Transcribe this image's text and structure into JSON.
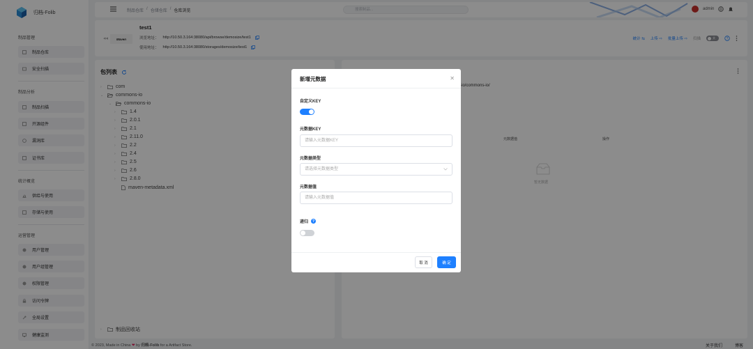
{
  "brand": {
    "name": "归档-Folib"
  },
  "sidebar": {
    "groups": [
      {
        "label": "制品管理",
        "items": [
          "制品仓库",
          "安全扫描"
        ]
      },
      {
        "label": "制品分析",
        "items": [
          "制品扫描",
          "开源组件",
          "漏洞库",
          "证书库"
        ]
      },
      {
        "label": "统计概览",
        "items": [
          "供给与使用",
          "存储与使用"
        ]
      },
      {
        "label": "运营管理",
        "items": [
          "用户管理",
          "用户组管理",
          "权限管理",
          "访问令牌",
          "全局设置",
          "健康监测"
        ]
      }
    ]
  },
  "header": {
    "breadcrumbs": [
      "制品仓库",
      "/",
      "仓储仓库",
      "/",
      "仓库浏览"
    ],
    "search_placeholder": "搜索制品...",
    "user": "admin"
  },
  "repo": {
    "name": "test1",
    "logo_text": "Maven",
    "browse_label": "浏览地址：",
    "browse_url": "http://10.50.3.164:38080/api/browse/demosize/test1",
    "use_label": "使用地址：",
    "use_url": "http://10.50.3.164:38080/storages/demosize/test1",
    "actions": [
      "统计 ⇆",
      "上传 ⇨",
      "批量上传 ⇨"
    ],
    "scan_label": "扫描",
    "scan_toggle": "关"
  },
  "package_list": {
    "title": "包列表",
    "tree": [
      {
        "label": "com",
        "kind": "folder",
        "depth": 0
      },
      {
        "label": "commons-io",
        "kind": "folder-open",
        "depth": 0
      },
      {
        "label": "commons-io",
        "kind": "folder-open",
        "depth": 1
      },
      {
        "label": "1.4",
        "kind": "folder",
        "depth": 2
      },
      {
        "label": "2.0.1",
        "kind": "folder",
        "depth": 2
      },
      {
        "label": "2.1",
        "kind": "folder",
        "depth": 2
      },
      {
        "label": "2.11.0",
        "kind": "folder",
        "depth": 2
      },
      {
        "label": "2.2",
        "kind": "folder",
        "depth": 2
      },
      {
        "label": "2.4",
        "kind": "folder",
        "depth": 2
      },
      {
        "label": "2.5",
        "kind": "folder",
        "depth": 2
      },
      {
        "label": "2.6",
        "kind": "folder",
        "depth": 2
      },
      {
        "label": "2.8.0",
        "kind": "folder",
        "depth": 2
      },
      {
        "label": "maven-metadata.xml",
        "kind": "file",
        "depth": 2
      }
    ],
    "recycle": "制品回收站"
  },
  "detail": {
    "path": "-io/commons-io/",
    "columns": [
      "元数据值",
      "操作"
    ],
    "empty_text": "暂无数据"
  },
  "footer": {
    "left_prefix": "© 2023, Made in China",
    "left_mid": "by",
    "brand": "归档-Folib",
    "left_suffix": "for a Artifact Store.",
    "links": [
      "关于我们",
      "博客"
    ]
  },
  "modal": {
    "title": "新增元数据",
    "custom_key_label": "自定义KEY",
    "custom_key_on": true,
    "key_label": "元数据KEY",
    "key_placeholder": "请输入元数据KEY",
    "type_label": "元数据类型",
    "type_placeholder": "请选择元数据类型",
    "value_label": "元数据值",
    "value_placeholder": "请输入元数据值",
    "recursive_label": "递归",
    "recursive_on": false,
    "cancel": "取 消",
    "ok": "确 定"
  },
  "colors": {
    "accent": "#1e80ff",
    "heart": "#e0245e",
    "avatar": "#c9302c"
  }
}
